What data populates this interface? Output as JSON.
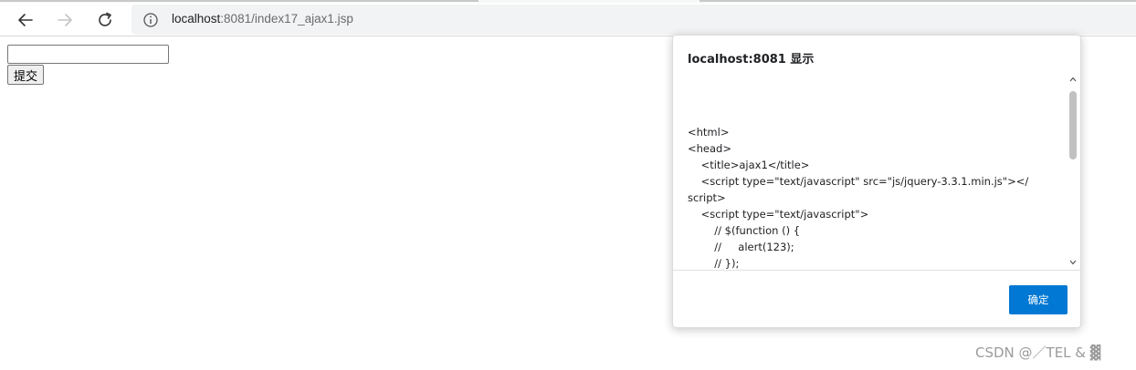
{
  "browser": {
    "url_host": "localhost",
    "url_rest": ":8081/index17_ajax1.jsp"
  },
  "page": {
    "text_input_value": "",
    "submit_label": "提交"
  },
  "dialog": {
    "title": "localhost:8081 显示",
    "message": "<html>\n<head>\n    <title>ajax1</title>\n    <script type=\"text/javascript\" src=\"js/jquery-3.3.1.min.js\"></\nscript>\n    <script type=\"text/javascript\">\n        // $(function () {\n        //     alert(123);\n        // });",
    "ok_label": "确定"
  },
  "watermark": "CSDN @／TEL⁨ & ▓",
  "colors": {
    "primary_button": "#0078d4",
    "address_bar_bg": "#f1f3f4"
  },
  "icons": [
    "back-arrow-icon",
    "forward-arrow-icon",
    "reload-icon",
    "info-icon",
    "scroll-up-icon",
    "scroll-down-icon"
  ]
}
